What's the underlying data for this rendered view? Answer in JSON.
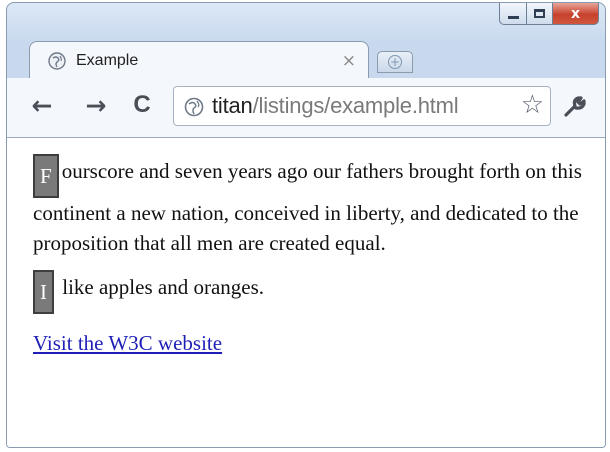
{
  "window": {
    "close_label": "x"
  },
  "tab": {
    "title": "Example",
    "close_glyph": "×",
    "icon": "globe-icon"
  },
  "toolbar": {
    "back_glyph": "←",
    "forward_glyph": "→",
    "reload_glyph": "C",
    "url_host": "titan",
    "url_path": "/listings/example.html",
    "star_glyph": "☆",
    "wrench_icon": "wrench-icon"
  },
  "content": {
    "para1_initial": "F",
    "para1_text": "ourscore and seven years ago our fathers brought forth on this continent a new nation, conceived in liberty, and dedicated to the proposition that all men are created equal.",
    "para2_initial": "I",
    "para2_text": "like apples and oranges.",
    "link_text": "Visit the W3C website"
  },
  "colors": {
    "link": "#1f1fb8",
    "initial_bg": "#7a7a7a",
    "close_red": "#c7412c"
  }
}
